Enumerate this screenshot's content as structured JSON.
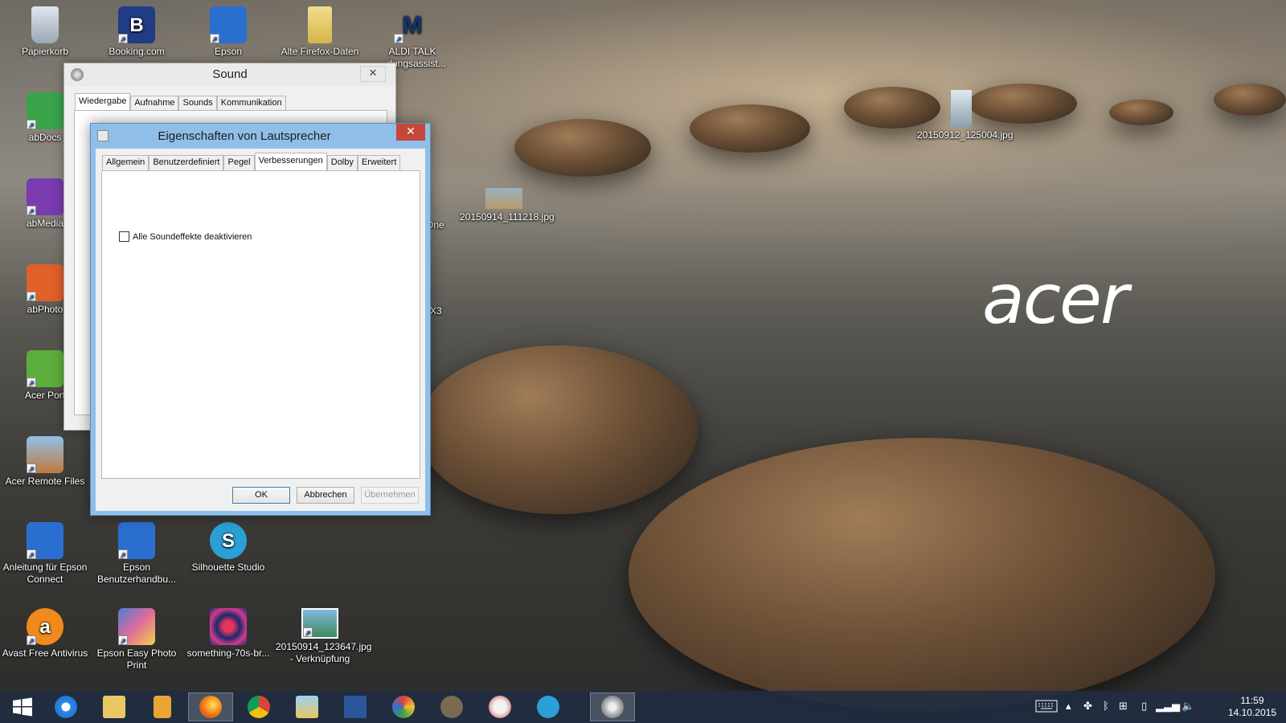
{
  "desktop": {
    "icons": [
      {
        "label": "Papierkorb",
        "icon": "recycle-bin-icon"
      },
      {
        "label": "Booking.com",
        "icon": "booking-icon"
      },
      {
        "label": "Epson",
        "icon": "epson-connect-icon"
      },
      {
        "label": "Alte Firefox-Daten",
        "icon": "folder-icon"
      },
      {
        "label": "ALDI TALK",
        "sub": "...dungsassist...",
        "icon": "aldi-talk-icon"
      },
      {
        "label": "abDocs",
        "icon": "abdocs-icon"
      },
      {
        "label": "abMedia",
        "icon": "abmedia-icon"
      },
      {
        "label": "abPhoto",
        "icon": "abphoto-icon"
      },
      {
        "label": "Acer Port",
        "icon": "acer-portal-icon"
      },
      {
        "label": "Acer Remote Files",
        "icon": "acer-remote-files-icon"
      },
      {
        "label": "Anleitung für Epson Connect",
        "icon": "epson-connect-icon"
      },
      {
        "label": "Epson Benutzerhandbu...",
        "icon": "epson-manual-icon"
      },
      {
        "label": "Silhouette Studio",
        "icon": "silhouette-icon"
      },
      {
        "label": "Avast Free Antivirus",
        "icon": "avast-icon"
      },
      {
        "label": "Epson Easy Photo Print",
        "icon": "epson-photo-icon"
      },
      {
        "label": "something-70s-br...",
        "icon": "image-file-icon"
      },
      {
        "label": "20150914_123647.jpg - Verknüpfung",
        "icon": "image-shortcut-icon"
      },
      {
        "label": "20150914_111218.jpg",
        "icon": "image-file-icon"
      },
      {
        "label": "20150912_125004.jpg",
        "icon": "image-file-icon"
      },
      {
        "label": "One",
        "icon": "partial-icon"
      },
      {
        "label": "X3",
        "icon": "partial-icon"
      }
    ],
    "brand": "acer"
  },
  "sound_window": {
    "title": "Sound",
    "tabs": [
      "Wiedergabe",
      "Aufnahme",
      "Sounds",
      "Kommunikation"
    ],
    "active_tab": "Wiedergabe",
    "close_label": "✕"
  },
  "props_window": {
    "title": "Eigenschaften von Lautsprecher",
    "tabs": [
      "Allgemein",
      "Benutzerdefiniert",
      "Pegel",
      "Verbesserungen",
      "Dolby",
      "Erweitert"
    ],
    "active_tab": "Verbesserungen",
    "checkbox_label": "Alle Soundeffekte deaktivieren",
    "checkbox_checked": false,
    "ok_label": "OK",
    "cancel_label": "Abbrechen",
    "apply_label": "Übernehmen",
    "close_label": "✕"
  },
  "taskbar": {
    "apps": [
      "start-icon",
      "internet-explorer-icon",
      "file-explorer-icon",
      "notes-icon",
      "firefox-icon",
      "chrome-icon",
      "photos-icon",
      "word-icon",
      "paint-icon",
      "gimp-icon",
      "snipping-icon",
      "skype-icon",
      "sound-icon"
    ],
    "time": "11:59",
    "date": "14.10.2015"
  },
  "colors": {
    "accent_title": "#8fbfe8",
    "close_red": "#c7463a",
    "taskbar": "#202c42"
  }
}
